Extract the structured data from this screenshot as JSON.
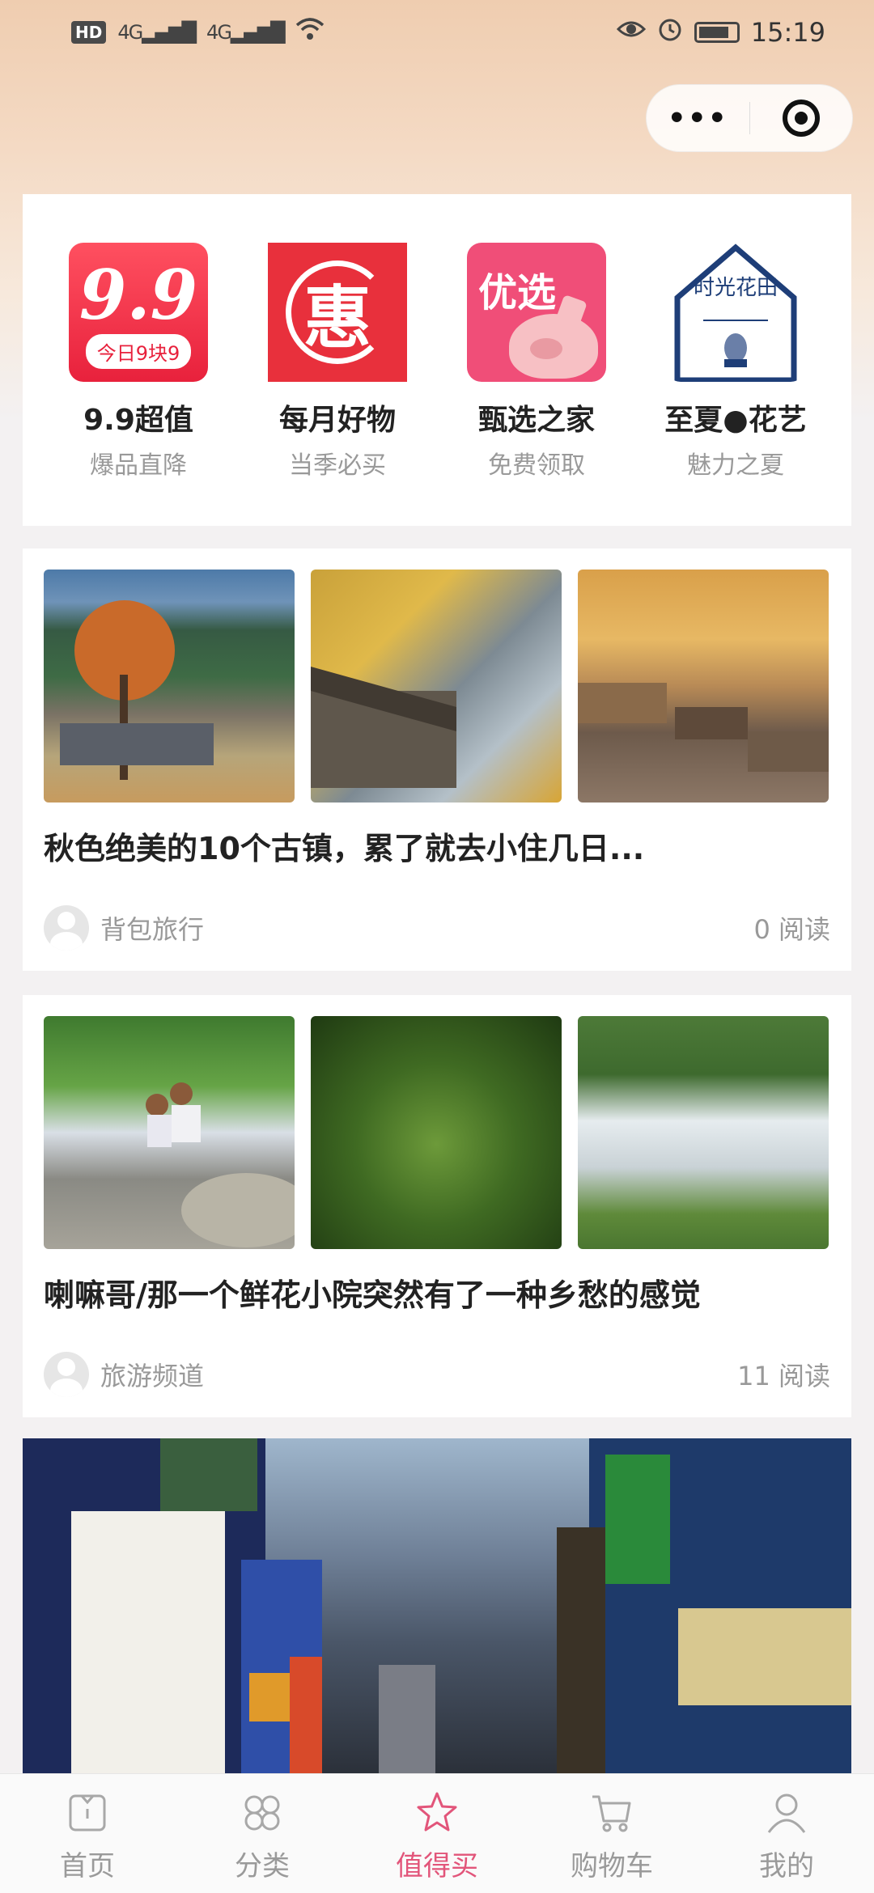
{
  "status_bar": {
    "hd_badge": "HD",
    "signal_1": "4G",
    "signal_2": "4G",
    "time": "15:19"
  },
  "capsule": {
    "more_label": "•••"
  },
  "quick_nav": [
    {
      "title": "9.9超值",
      "subtitle": "爆品直降",
      "icon_text": "9.9",
      "icon_pill": "今日9块9",
      "icon": "nine-nine-icon"
    },
    {
      "title": "每月好物",
      "subtitle": "当季必买",
      "icon_text": "惠",
      "icon": "hui-icon"
    },
    {
      "title": "甄选之家",
      "subtitle": "免费领取",
      "icon_text": "优选",
      "icon": "youxuan-pig-icon"
    },
    {
      "title": "至夏●花艺",
      "subtitle": "魅力之夏",
      "icon_text": "时光花田",
      "icon": "house-logo-icon"
    }
  ],
  "articles": [
    {
      "title": "秋色绝美的10个古镇，累了就去小住几日...",
      "author": "背包旅行",
      "reads": "0 阅读"
    },
    {
      "title": "喇嘛哥/那一个鲜花小院突然有了一种乡愁的感觉",
      "author": "旅游频道",
      "reads": "11 阅读"
    }
  ],
  "tab_bar": [
    {
      "label": "首页",
      "icon": "home-icon"
    },
    {
      "label": "分类",
      "icon": "category-icon"
    },
    {
      "label": "值得买",
      "icon": "star-icon",
      "active": true
    },
    {
      "label": "购物车",
      "icon": "cart-icon"
    },
    {
      "label": "我的",
      "icon": "profile-icon"
    }
  ],
  "colors": {
    "accent": "#e2557a",
    "red": "#e8303c",
    "pink": "#f04e78",
    "navy": "#1e3e78"
  }
}
